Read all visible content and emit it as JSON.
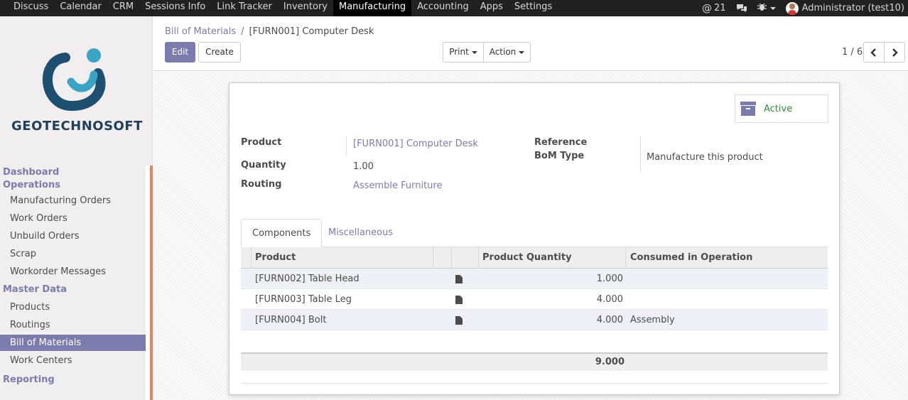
{
  "topbar": {
    "menu": [
      "Discuss",
      "Calendar",
      "CRM",
      "Sessions Info",
      "Link Tracker",
      "Inventory",
      "Manufacturing",
      "Accounting",
      "Apps",
      "Settings"
    ],
    "active_menu": "Manufacturing",
    "mention_count": "21",
    "user": "Administrator (test10)"
  },
  "sidebar": {
    "logo_text": "GEOTECHNOSOFT",
    "sections": [
      {
        "header": "Dashboard",
        "items": []
      },
      {
        "header": "Operations",
        "items": [
          "Manufacturing Orders",
          "Work Orders",
          "Unbuild Orders",
          "Scrap",
          "Workorder Messages"
        ]
      },
      {
        "header": "Master Data",
        "items": [
          "Products",
          "Routings",
          "Bill of Materials",
          "Work Centers"
        ]
      },
      {
        "header": "Reporting",
        "items": []
      }
    ],
    "active_item": "Bill of Materials"
  },
  "control": {
    "breadcrumb_root": "Bill of Materials",
    "breadcrumb_sep": "/",
    "breadcrumb_current": "[FURN001] Computer Desk",
    "edit_label": "Edit",
    "create_label": "Create",
    "print_label": "Print",
    "action_label": "Action",
    "pager": "1 / 6"
  },
  "form": {
    "active_label": "Active",
    "product_label": "Product",
    "product_value": "[FURN001] Computer Desk",
    "quantity_label": "Quantity",
    "quantity_value": "1.00",
    "routing_label": "Routing",
    "routing_value": "Assemble Furniture",
    "reference_label": "Reference",
    "bom_type_label": "BoM Type",
    "bom_type_value": "Manufacture this product"
  },
  "tabs": [
    "Components",
    "Miscellaneous"
  ],
  "components": {
    "columns": [
      "Product",
      "Product Quantity",
      "Consumed in Operation"
    ],
    "rows": [
      {
        "product": "[FURN002] Table Head",
        "qty": "1.000",
        "operation": ""
      },
      {
        "product": "[FURN003] Table Leg",
        "qty": "4.000",
        "operation": ""
      },
      {
        "product": "[FURN004] Bolt",
        "qty": "4.000",
        "operation": "Assembly"
      }
    ],
    "total": "9.000"
  },
  "colors": {
    "primary": "#7c7bad",
    "topbar": "#212121",
    "active_green": "#2f8e3f",
    "scroll_accent": "#e6845d"
  }
}
